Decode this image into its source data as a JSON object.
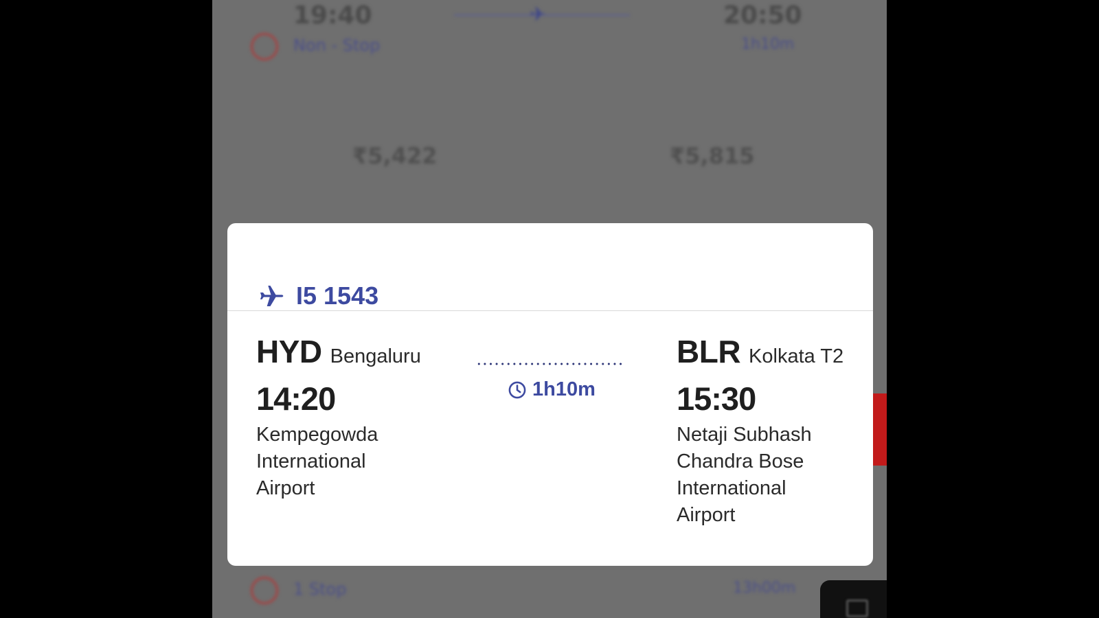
{
  "background": {
    "top_row": {
      "depart_time": "19:40",
      "arrive_time": "20:50",
      "stops": "Non - Stop",
      "duration": "1h10m"
    },
    "prices": [
      "₹5,422",
      "₹5,815"
    ],
    "bottom_row": {
      "stops": "1 Stop",
      "duration": "13h00m"
    }
  },
  "modal": {
    "flight_number": "I5 1543",
    "departure": {
      "code": "HYD",
      "city": "Bengaluru",
      "time": "14:20",
      "airport_lines": [
        "Kempegowda",
        "International",
        "Airport"
      ]
    },
    "duration": "1h10m",
    "arrival": {
      "code": "BLR",
      "city": "Kolkata T2",
      "time": "15:30",
      "airport_lines": [
        "Netaji Subhash",
        "Chandra Bose",
        "International",
        "Airport"
      ]
    }
  },
  "colors": {
    "accent": "#3d4aa0",
    "overlay": "#6f6f6f",
    "modal_bg": "#ffffff",
    "alert_red": "#c21a1a"
  },
  "icons": {
    "flight": "airplane-icon",
    "duration": "clock-icon"
  }
}
